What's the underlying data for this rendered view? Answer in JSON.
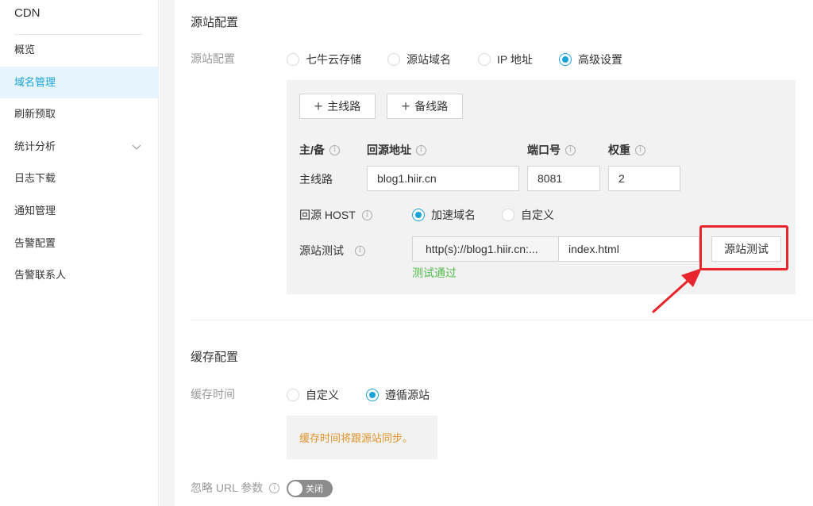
{
  "sidebar": {
    "title": "CDN",
    "items": [
      {
        "label": "概览",
        "active": false
      },
      {
        "label": "域名管理",
        "active": true
      },
      {
        "label": "刷新预取",
        "active": false
      },
      {
        "label": "统计分析",
        "active": false,
        "has_chevron": true
      },
      {
        "label": "日志下载",
        "active": false
      },
      {
        "label": "通知管理",
        "active": false
      },
      {
        "label": "告警配置",
        "active": false
      },
      {
        "label": "告警联系人",
        "active": false
      }
    ]
  },
  "origin": {
    "section_title": "源站配置",
    "field_label": "源站配置",
    "options": [
      {
        "label": "七牛云存储",
        "checked": false
      },
      {
        "label": "源站域名",
        "checked": false
      },
      {
        "label": "IP 地址",
        "checked": false
      },
      {
        "label": "高级设置",
        "checked": true
      }
    ],
    "add_main_line_label": "主线路",
    "add_backup_line_label": "备线路",
    "columns": {
      "type": "主/备",
      "address": "回源地址",
      "port": "端口号",
      "weight": "权重"
    },
    "row": {
      "type": "主线路",
      "address": "blog1.hiir.cn",
      "port": "8081",
      "weight": "2"
    },
    "host": {
      "label": "回源 HOST",
      "options": [
        {
          "label": "加速域名",
          "checked": true
        },
        {
          "label": "自定义",
          "checked": false
        }
      ]
    },
    "test": {
      "label": "源站测试",
      "url_prefix": "http(s)://blog1.hiir.cn:...",
      "path_value": "index.html",
      "button_label": "源站测试",
      "result": "测试通过"
    }
  },
  "cache": {
    "section_title": "缓存配置",
    "field_label": "缓存时间",
    "options": [
      {
        "label": "自定义",
        "checked": false
      },
      {
        "label": "遵循源站",
        "checked": true
      }
    ],
    "note": "缓存时间将跟源站同步。",
    "ignore_url_label": "忽略 URL 参数",
    "ignore_url_toggle": "关闭"
  },
  "colors": {
    "accent": "#1aa3d8",
    "success": "#52b94a",
    "warning": "#e0932b",
    "highlight": "#e8242c"
  }
}
